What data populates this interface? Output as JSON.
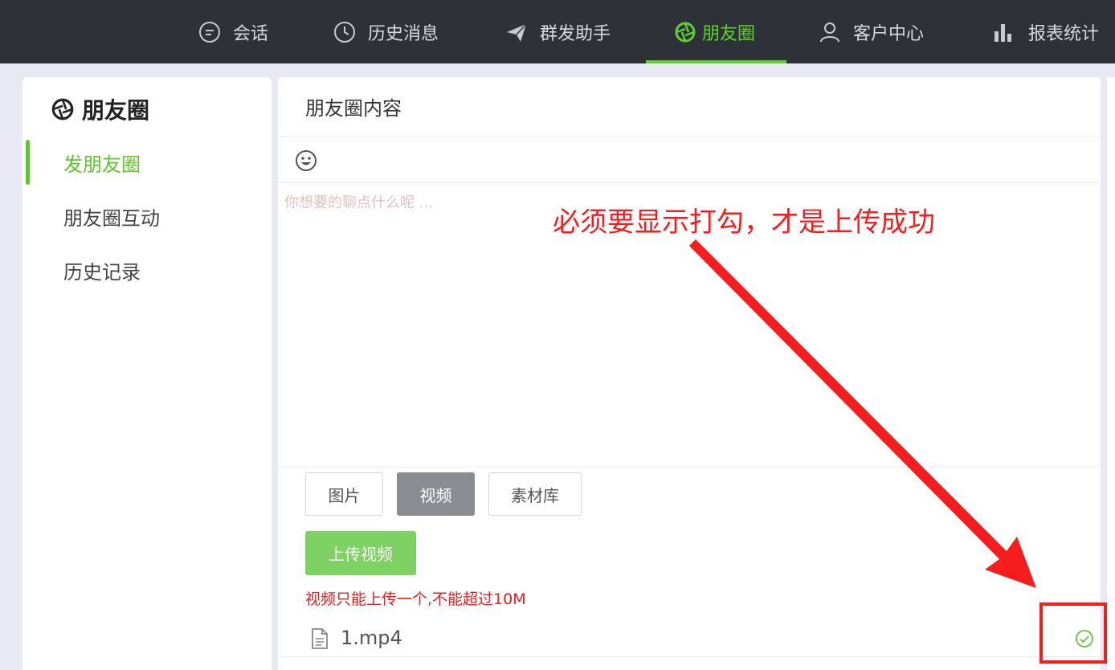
{
  "nav": {
    "items": [
      {
        "label": "会话",
        "icon": "chat-bubble-icon"
      },
      {
        "label": "历史消息",
        "icon": "clock-icon"
      },
      {
        "label": "群发助手",
        "icon": "paper-plane-icon"
      },
      {
        "label": "朋友圈",
        "icon": "aperture-icon",
        "active": true
      },
      {
        "label": "客户中心",
        "icon": "user-icon"
      },
      {
        "label": "报表统计",
        "icon": "bar-chart-icon"
      }
    ],
    "active_color": "#5fd12f"
  },
  "sidebar": {
    "title": "朋友圈",
    "title_icon": "aperture-icon",
    "items": [
      {
        "label": "发朋友圈",
        "active": true
      },
      {
        "label": "朋友圈互动"
      },
      {
        "label": "历史记录"
      }
    ]
  },
  "main": {
    "header": "朋友圈内容",
    "emoji_icon": "smiley-icon",
    "editor_placeholder": "你想要的聊点什么呢 ...",
    "tabs": [
      {
        "label": "图片"
      },
      {
        "label": "视频",
        "active": true
      },
      {
        "label": "素材库"
      }
    ],
    "upload_button": "上传视频",
    "upload_hint": "视频只能上传一个,不能超过10M",
    "file": {
      "name": "1.mp4",
      "icon": "document-icon",
      "status_icon": "check-circle-icon"
    }
  },
  "annotation": {
    "text": "必须要显示打勾，才是上传成功",
    "color": "#f51d1d"
  }
}
